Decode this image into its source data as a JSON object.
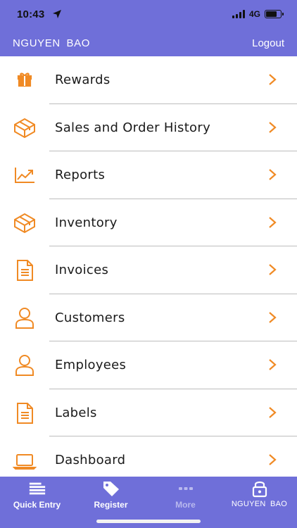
{
  "status_bar": {
    "time": "10:43",
    "network": "4G",
    "battery_level": 0.75
  },
  "header": {
    "user_name": "NGUYEN  BAO",
    "logout_label": "Logout"
  },
  "accent_color": "#f08a24",
  "bar_color": "#6f6fd9",
  "menu": {
    "items": [
      {
        "label": "Rewards",
        "icon": "gift-icon"
      },
      {
        "label": "Sales and Order History",
        "icon": "cube-icon"
      },
      {
        "label": "Reports",
        "icon": "trend-chart-icon"
      },
      {
        "label": "Inventory",
        "icon": "cube-icon"
      },
      {
        "label": "Invoices",
        "icon": "document-icon"
      },
      {
        "label": "Customers",
        "icon": "person-icon"
      },
      {
        "label": "Employees",
        "icon": "person-icon"
      },
      {
        "label": "Labels",
        "icon": "document-icon"
      },
      {
        "label": "Dashboard",
        "icon": "laptop-icon"
      }
    ]
  },
  "tab_bar": {
    "tabs": [
      {
        "label": "Quick Entry",
        "icon": "list-lines-icon"
      },
      {
        "label": "Register",
        "icon": "tag-icon"
      },
      {
        "label": "More",
        "icon": "dots-icon"
      },
      {
        "label": "NGUYEN  BAO",
        "icon": "lock-icon"
      }
    ]
  }
}
